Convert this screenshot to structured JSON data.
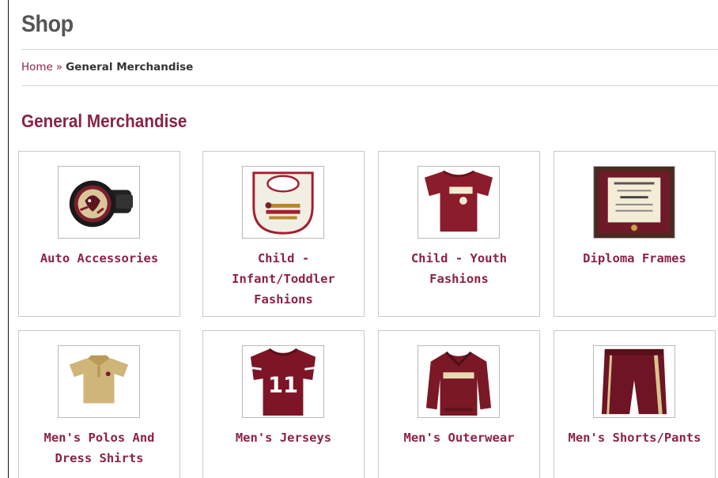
{
  "header": {
    "title": "Shop"
  },
  "breadcrumb": {
    "home": "Home",
    "separator": "»",
    "current": "General Merchandise"
  },
  "section": {
    "title": "General Merchandise"
  },
  "categories": [
    {
      "label": "Auto Accessories",
      "icon": "hitch-cover-icon"
    },
    {
      "label": "Child - Infant/Toddler Fashions",
      "icon": "bib-icon"
    },
    {
      "label": "Child - Youth Fashions",
      "icon": "tshirt-icon"
    },
    {
      "label": "Diploma Frames",
      "icon": "diploma-frame-icon"
    },
    {
      "label": "Men's Polos And Dress Shirts",
      "icon": "polo-icon"
    },
    {
      "label": "Men's Jerseys",
      "icon": "jersey-icon"
    },
    {
      "label": "Men's Outerwear",
      "icon": "pullover-icon"
    },
    {
      "label": "Men's Shorts/Pants",
      "icon": "shorts-icon"
    }
  ],
  "colors": {
    "accent": "#8b2248",
    "garnet": "#7a1f2b",
    "gold": "#c9b27a"
  }
}
